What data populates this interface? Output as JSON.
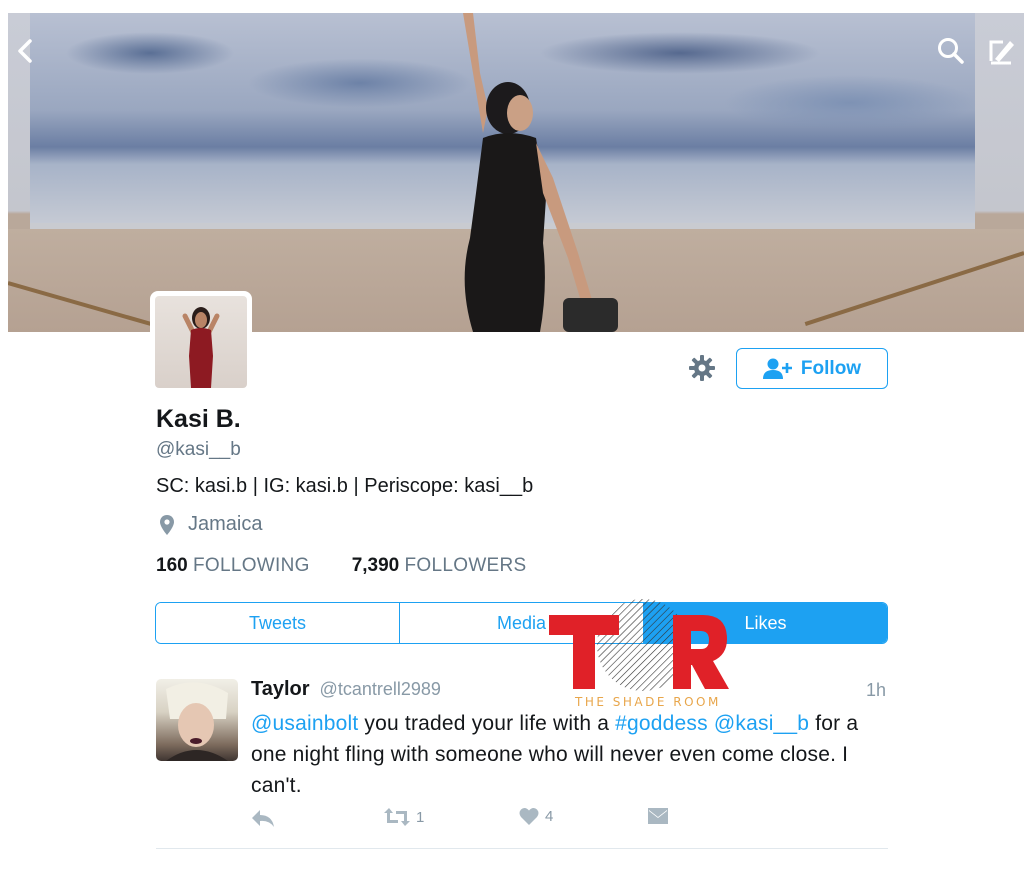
{
  "header": {
    "back_icon": "chevron-left-icon",
    "search_icon": "search-icon",
    "compose_icon": "compose-tweet-icon"
  },
  "profile": {
    "name": "Kasi B.",
    "handle": "@kasi__b",
    "bio": "SC: kasi.b | IG: kasi.b | Periscope: kasi__b",
    "location": "Jamaica",
    "following_count": "160",
    "following_label": "FOLLOWING",
    "followers_count": "7,390",
    "followers_label": "FOLLOWERS"
  },
  "actions": {
    "settings_icon": "gear-icon",
    "follow_label": "Follow"
  },
  "tabs": [
    {
      "label": "Tweets",
      "active": false
    },
    {
      "label": "Media",
      "active": false
    },
    {
      "label": "Likes",
      "active": true
    }
  ],
  "watermark": {
    "logo": "TSR",
    "text": "THE SHADE ROOM"
  },
  "tweet": {
    "name": "Taylor",
    "handle": "@tcantrell2989",
    "time": "1h",
    "mention_1": "@usainbolt",
    "text_1": " you traded your life with a ",
    "hashtag": "#goddess",
    "text_2": " ",
    "mention_2": "@kasi__b",
    "text_3": " for a one night fling with someone who will never even come close. I can't.",
    "retweet_count": "1",
    "like_count": "4"
  },
  "colors": {
    "accent": "#1da1f2",
    "muted": "#657786",
    "watermark_red": "#e02128",
    "watermark_gold": "#e8a64b"
  }
}
